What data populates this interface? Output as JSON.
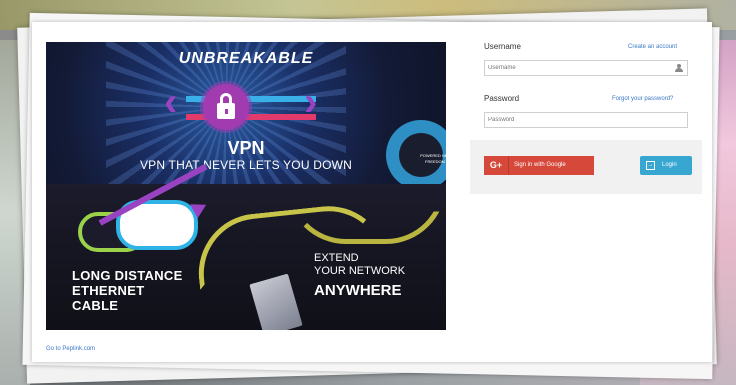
{
  "banner": {
    "headline": "UNBREAKABLE",
    "product": "VPN",
    "tagline": "VPN THAT NEVER LETS YOU DOWN",
    "badge_text": "POWERED NET FREEDOM",
    "cable_title_lines": [
      "LONG DISTANCE",
      "ETHERNET",
      "CABLE"
    ],
    "extend_lines": [
      "EXTEND",
      "YOUR NETWORK"
    ],
    "anywhere": "ANYWHERE"
  },
  "login": {
    "username_label": "Username",
    "create_account_link": "Create an account",
    "username_placeholder": "Username",
    "password_label": "Password",
    "forgot_password_link": "Forgot your password?",
    "password_placeholder": "Password",
    "google_icon": "G+",
    "google_button_label": "Sign in with Google",
    "login_button_label": "Login"
  },
  "footer": {
    "back_link": "Go to Peplink.com"
  },
  "icons": {
    "user": "user-icon",
    "lock": "lock-icon",
    "login": "login-icon",
    "google": "google-plus-icon"
  },
  "colors": {
    "google_red": "#d5483a",
    "login_blue": "#37a6d0",
    "link_blue": "#3b78c9"
  }
}
